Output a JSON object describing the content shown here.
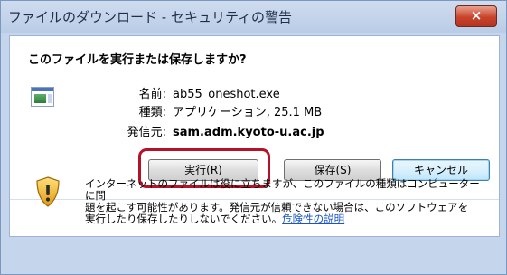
{
  "window": {
    "title": "ファイルのダウンロード - セキュリティの警告",
    "close_label": "×"
  },
  "dialog": {
    "question": "このファイルを実行または保存しますか?",
    "file_icon": "program-file-icon",
    "fields": {
      "name_label": "名前:",
      "name_value": "ab55_oneshot.exe",
      "type_label": "種類:",
      "type_value": "アプリケーション, 25.1 MB",
      "from_label": "発信元:",
      "from_value": "sam.adm.kyoto-u.ac.jp"
    },
    "buttons": {
      "run": "実行(R)",
      "save": "保存(S)",
      "cancel": "キャンセル"
    },
    "highlight_color": "#b5122a",
    "warning": {
      "icon": "security-shield-icon",
      "line1": "インターネットのファイルは役に立ちますが、このファイルの種類はコンピューターに問",
      "line2": "題を起こす可能性があります。発信元が信頼できない場合は、このソフトウェアを",
      "line3": "実行したり保存したりしないでください。",
      "risk_link": "危険性の説明"
    }
  }
}
